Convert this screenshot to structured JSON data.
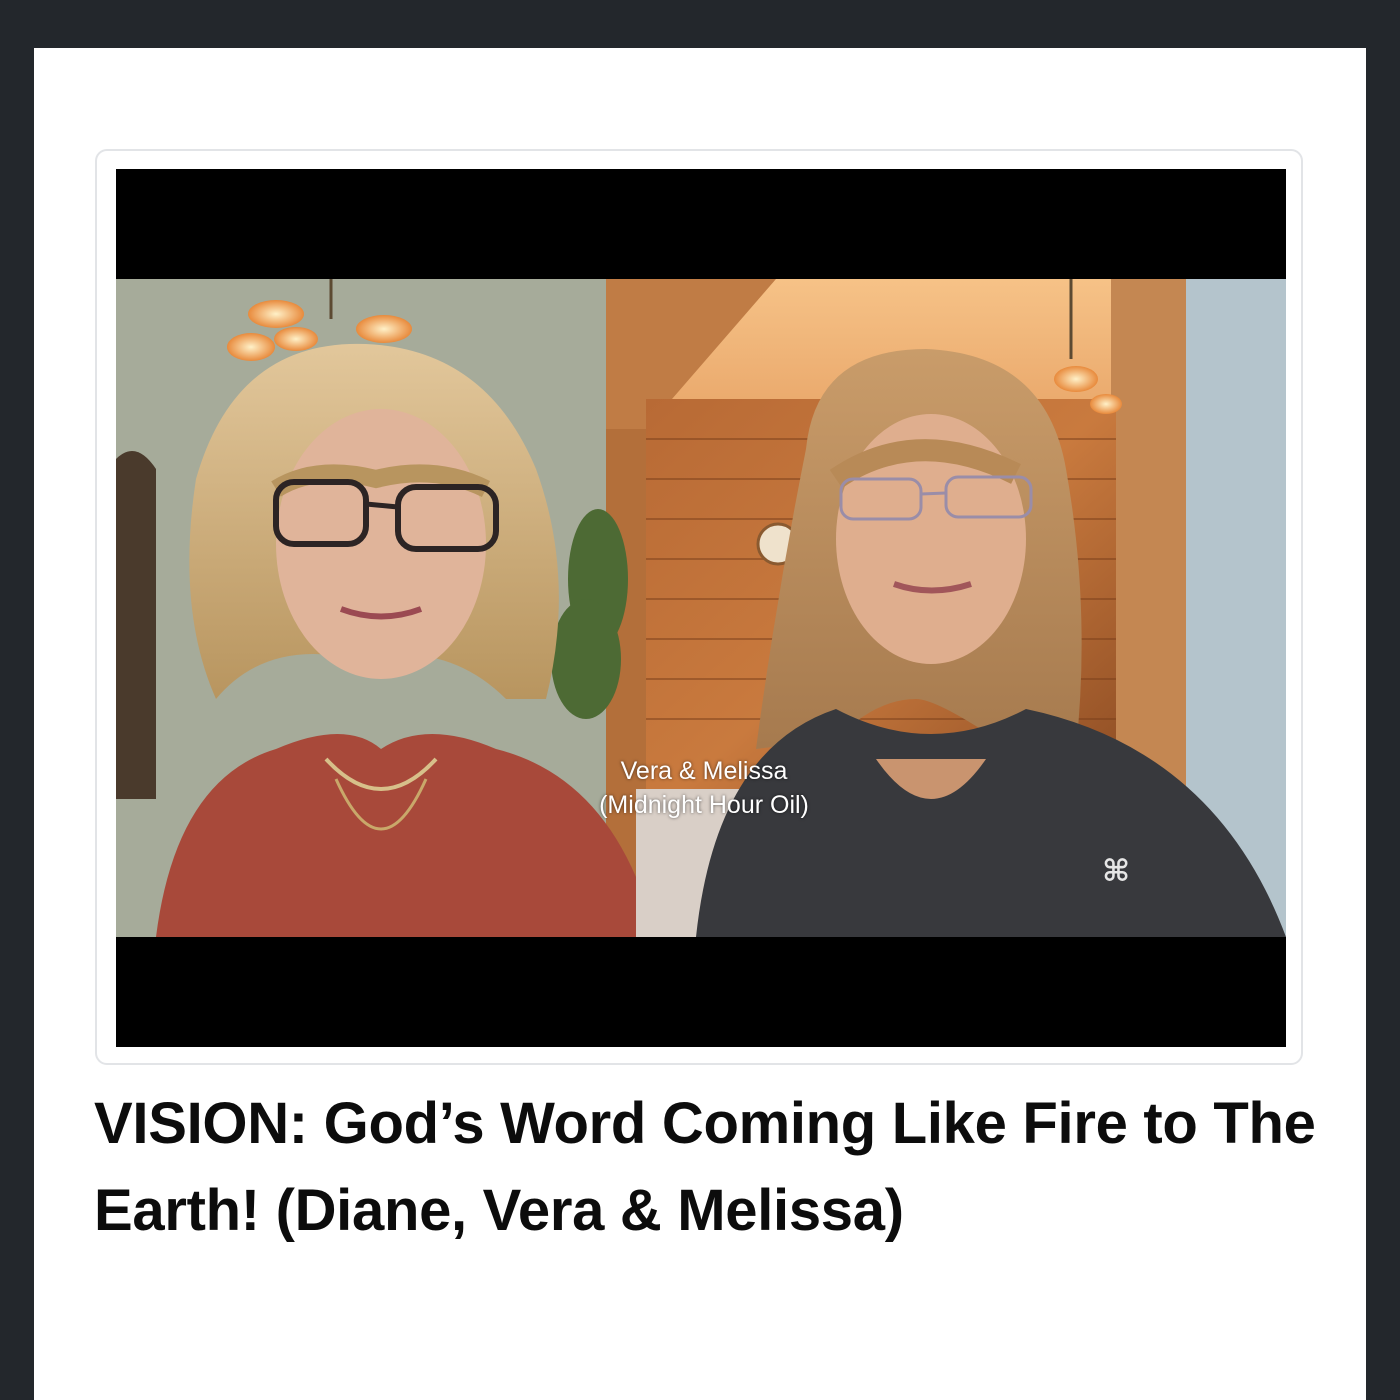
{
  "post": {
    "title": "VISION: God’s Word Coming Like Fire to The Earth! (Diane, Vera & Melissa)",
    "video": {
      "caption_line1": "Vera & Melissa",
      "caption_line2": "(Midnight Hour Oil)"
    }
  },
  "colors": {
    "page_background": "#23272c",
    "card_background": "#ffffff",
    "title_text": "#0c0c0c",
    "letterbox": "#000000"
  }
}
